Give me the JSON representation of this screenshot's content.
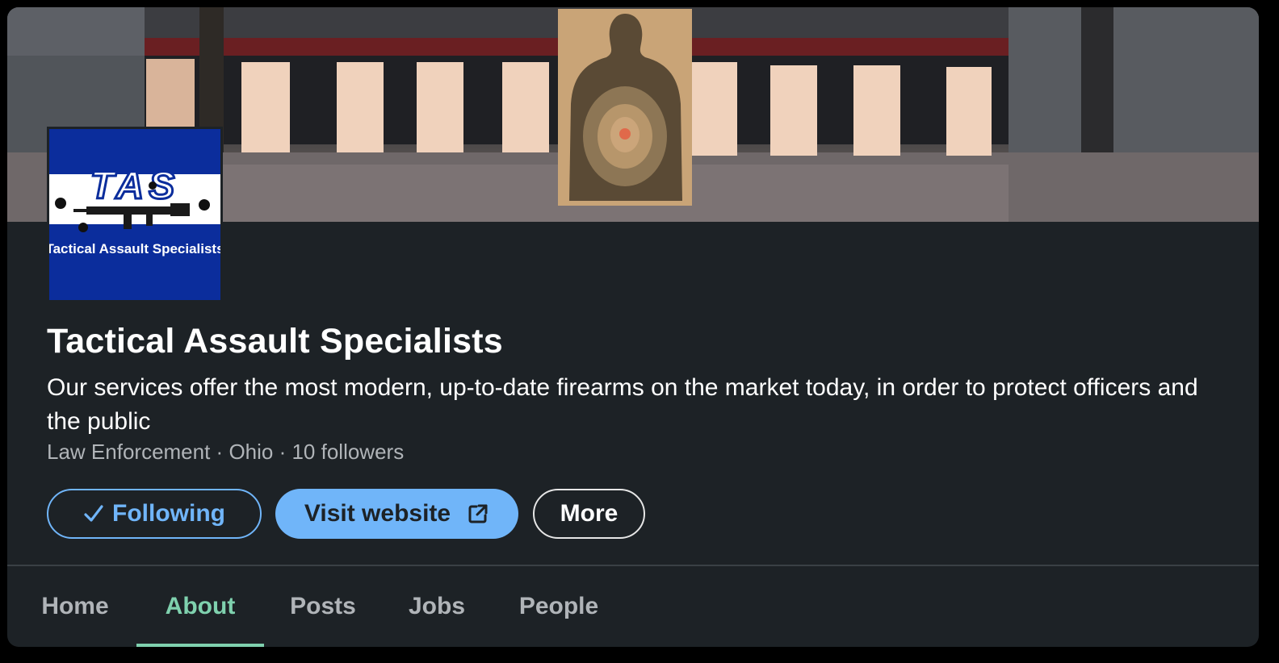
{
  "company": {
    "logo_text": "TAS",
    "logo_subtext": "Tactical Assault Specialists",
    "name": "Tactical Assault Specialists",
    "tagline": "Our services offer the most modern, up-to-date firearms on the market today, in order to protect officers and the public",
    "industry": "Law Enforcement",
    "location": "Ohio",
    "followers": "10 followers",
    "separator": " · "
  },
  "actions": {
    "following_label": "Following",
    "visit_label": "Visit website",
    "more_label": "More"
  },
  "tabs": [
    {
      "label": "Home",
      "active": false
    },
    {
      "label": "About",
      "active": true
    },
    {
      "label": "Posts",
      "active": false
    },
    {
      "label": "Jobs",
      "active": false
    },
    {
      "label": "People",
      "active": false
    }
  ],
  "icons": {
    "check": "checkmark-icon",
    "external": "external-link-icon"
  },
  "colors": {
    "background": "#1d2226",
    "accent_blue": "#70b5f9",
    "active_tab": "#7fd1ae",
    "logo_blue": "#0b2d9c"
  }
}
